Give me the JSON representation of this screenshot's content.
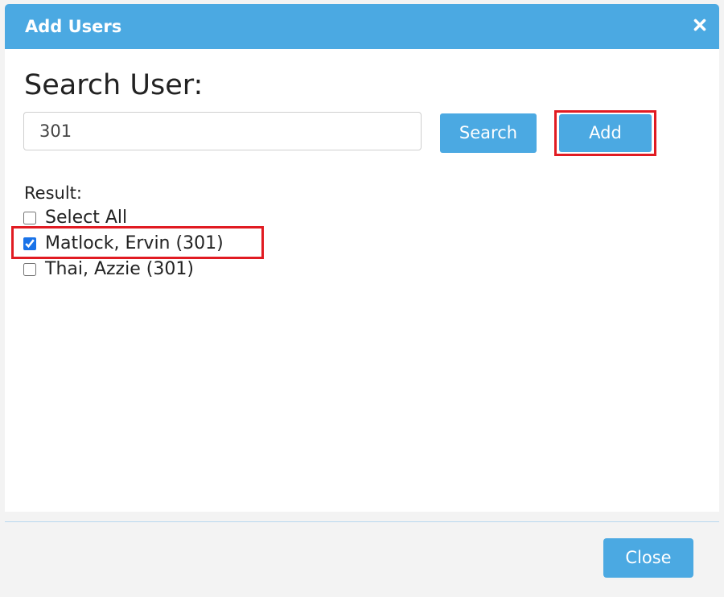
{
  "dialog": {
    "title": "Add Users",
    "close_icon": "close-icon"
  },
  "search": {
    "heading": "Search User:",
    "input_value": "301",
    "search_label": "Search",
    "add_label": "Add"
  },
  "results": {
    "label": "Result:",
    "select_all": {
      "label": "Select All",
      "checked": false
    },
    "items": [
      {
        "label": "Matlock, Ervin (301)",
        "checked": true
      },
      {
        "label": "Thai, Azzie (301)",
        "checked": false
      }
    ]
  },
  "footer": {
    "close_label": "Close"
  },
  "colors": {
    "accent": "#4ba9e2",
    "highlight": "#e11b22"
  }
}
